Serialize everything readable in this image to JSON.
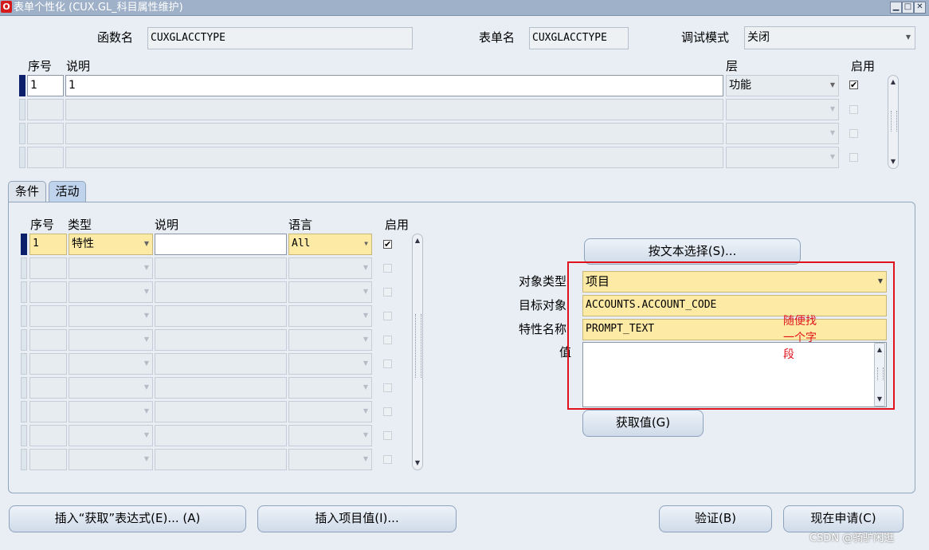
{
  "window": {
    "title": "表单个性化 (CUX.GL_科目属性维护)",
    "icon": "oracle-icon",
    "controls": [
      "minimize",
      "maximize",
      "close"
    ]
  },
  "header": {
    "function_label": "函数名",
    "function_value": "CUXGLACCTYPE",
    "form_label": "表单名",
    "form_value": "CUXGLACCTYPE",
    "debug_label": "调试模式",
    "debug_value": "关闭"
  },
  "rules": {
    "col_seq": "序号",
    "col_desc": "说明",
    "col_level": "层",
    "col_enabled": "启用",
    "rows": [
      {
        "seq": "1",
        "desc": "1",
        "level": "功能",
        "enabled": true
      },
      {
        "seq": "",
        "desc": "",
        "level": "",
        "enabled": false
      },
      {
        "seq": "",
        "desc": "",
        "level": "",
        "enabled": false
      },
      {
        "seq": "",
        "desc": "",
        "level": "",
        "enabled": false
      }
    ]
  },
  "tabs": {
    "conditions": "条件",
    "actions": "活动",
    "active": "actions"
  },
  "actions": {
    "col_seq": "序号",
    "col_type": "类型",
    "col_desc": "说明",
    "col_lang": "语言",
    "col_enabled": "启用",
    "rows": [
      {
        "seq": "1",
        "type": "特性",
        "desc": "",
        "lang": "All",
        "enabled": true
      },
      {
        "seq": "",
        "type": "",
        "desc": "",
        "lang": "",
        "enabled": false
      },
      {
        "seq": "",
        "type": "",
        "desc": "",
        "lang": "",
        "enabled": false
      },
      {
        "seq": "",
        "type": "",
        "desc": "",
        "lang": "",
        "enabled": false
      },
      {
        "seq": "",
        "type": "",
        "desc": "",
        "lang": "",
        "enabled": false
      },
      {
        "seq": "",
        "type": "",
        "desc": "",
        "lang": "",
        "enabled": false
      },
      {
        "seq": "",
        "type": "",
        "desc": "",
        "lang": "",
        "enabled": false
      },
      {
        "seq": "",
        "type": "",
        "desc": "",
        "lang": "",
        "enabled": false
      },
      {
        "seq": "",
        "type": "",
        "desc": "",
        "lang": "",
        "enabled": false
      },
      {
        "seq": "",
        "type": "",
        "desc": "",
        "lang": "",
        "enabled": false
      }
    ]
  },
  "detail": {
    "select_by_text": "按文本选择(S)...",
    "object_type_label": "对象类型",
    "object_type_value": "项目",
    "target_label": "目标对象",
    "target_value": "ACCOUNTS.ACCOUNT_CODE",
    "property_label": "特性名称",
    "property_value": "PROMPT_TEXT",
    "value_label": "值",
    "value_value": "",
    "get_value": "获取值(G)",
    "annotation_lines": [
      "随便找",
      "一个字",
      "段"
    ]
  },
  "footer": {
    "insert_get_expr": "插入“获取”表达式(E)... (A)",
    "insert_item_value": "插入项目值(I)...",
    "validate": "验证(B)",
    "apply_now": "现在申请(C)"
  },
  "watermark": "CSDN @骑驴闲逛"
}
